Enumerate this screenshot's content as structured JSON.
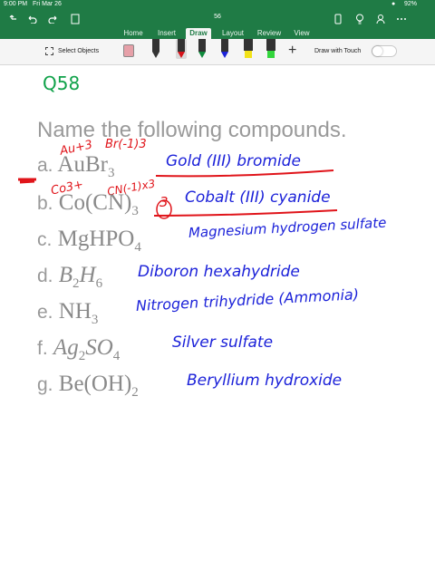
{
  "status": {
    "time": "9:00 PM",
    "date": "Fri Mar 26",
    "battery": "92%"
  },
  "document": {
    "title": "56"
  },
  "tabs": [
    {
      "label": "Home",
      "active": false
    },
    {
      "label": "Insert",
      "active": false
    },
    {
      "label": "Draw",
      "active": true
    },
    {
      "label": "Layout",
      "active": false
    },
    {
      "label": "Review",
      "active": false
    },
    {
      "label": "View",
      "active": false
    }
  ],
  "ribbon": {
    "select_objects_label": "Select Objects",
    "draw_with_touch_label": "Draw with Touch",
    "draw_with_touch_on": false
  },
  "colors": {
    "accent": "#1f7b45",
    "ink_blue": "#1c22d9",
    "ink_red": "#e0141a",
    "ink_green": "#10a24a"
  },
  "page": {
    "question_number": "Q58",
    "heading": "Name the following compounds.",
    "items": [
      {
        "letter": "a.",
        "formula": "AuBr",
        "sub": "3",
        "answer": "Gold (III) bromide"
      },
      {
        "letter": "b.",
        "formula": "Co(CN)",
        "sub": "3",
        "answer": "Cobalt (III) cyanide"
      },
      {
        "letter": "c.",
        "formula": "MgHPO",
        "sub": "4",
        "answer": "Magnesium hydrogen sulfate"
      },
      {
        "letter": "d.",
        "formula_parts": [
          "B",
          "2",
          "H",
          "6"
        ],
        "answer": "Diboron hexahydride"
      },
      {
        "letter": "e.",
        "formula": "NH",
        "sub": "3",
        "answer": "Nitrogen trihydride (Ammonia)"
      },
      {
        "letter": "f.",
        "formula_parts": [
          "Ag",
          "2",
          "SO",
          "4"
        ],
        "answer": "Silver sulfate"
      },
      {
        "letter": "g.",
        "formula": "Be(OH)",
        "sub": "2",
        "answer": "Beryllium hydroxide"
      }
    ],
    "red_notes": {
      "au_ion": "Au+3",
      "br_ion": "Br(-1)3",
      "co_ion": "Co3+",
      "cn_ion": "CN(-1)x3",
      "tail_mark": "3"
    }
  }
}
